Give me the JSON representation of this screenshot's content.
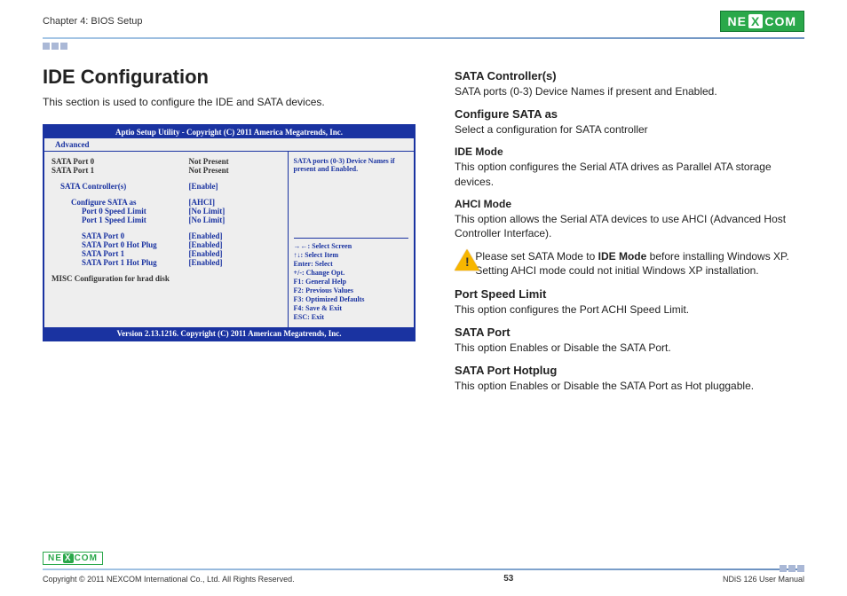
{
  "header": {
    "chapter": "Chapter 4: BIOS Setup",
    "logo_left": "NE",
    "logo_x": "X",
    "logo_right": "COM"
  },
  "title": "IDE Configuration",
  "intro": "This section is used to configure the IDE and SATA devices.",
  "bios": {
    "titlebar": "Aptio Setup Utility - Copyright (C) 2011 America Megatrends, Inc.",
    "tab": "Advanced",
    "rows": {
      "port0_lbl": "SATA Port 0",
      "port0_val": "Not Present",
      "port1_lbl": "SATA Port 1",
      "port1_val": "Not Present",
      "ctrl_lbl": "SATA Controller(s)",
      "ctrl_val": "[Enable]",
      "cfg_lbl": "Configure SATA as",
      "cfg_val": "[AHCI]",
      "p0s_lbl": "Port 0 Speed Limit",
      "p0s_val": "[No Limit]",
      "p1s_lbl": "Port 1 Speed Limit",
      "p1s_val": "[No Limit]",
      "sp0_lbl": "SATA Port 0",
      "sp0_val": "[Enabled]",
      "sp0h_lbl": "SATA Port 0 Hot Plug",
      "sp0h_val": "[Enabled]",
      "sp1_lbl": "SATA Port 1",
      "sp1_val": "[Enabled]",
      "sp1h_lbl": "SATA Port 1 Hot Plug",
      "sp1h_val": "[Enabled]",
      "misc": "MISC Configuration for hrad disk"
    },
    "help_top": "SATA ports (0-3) Device Names if present and Enabled.",
    "keys": {
      "k1": "→←: Select Screen",
      "k2": "↑↓: Select Item",
      "k3": "Enter: Select",
      "k4": "+/-: Change Opt.",
      "k5": "F1: General Help",
      "k6": "F2: Previous Values",
      "k7": "F3: Optimized Defaults",
      "k8": "F4: Save & Exit",
      "k9": "ESC: Exit"
    },
    "footer": "Version 2.13.1216. Copyright (C) 2011 American Megatrends, Inc."
  },
  "right": {
    "h_sata_ctrl": "SATA Controller(s)",
    "p_sata_ctrl": "SATA ports (0-3) Device Names if present and Enabled.",
    "h_cfg": "Configure SATA as",
    "p_cfg": "Select a configuration for SATA controller",
    "h_ide": "IDE Mode",
    "p_ide": "This option configures the Serial ATA drives as Parallel ATA storage devices.",
    "h_ahci": "AHCI Mode",
    "p_ahci": "This option allows the Serial ATA devices to use AHCI (Advanced Host Controller Interface).",
    "warn_a": "Please set SATA Mode to ",
    "warn_bold": "IDE Mode",
    "warn_b": " before installing Windows XP. Setting AHCI mode could not initial Windows XP installation.",
    "h_psl": "Port Speed Limit",
    "p_psl": "This option configures the Port ACHI Speed Limit.",
    "h_sp": "SATA Port",
    "p_sp": "This option Enables or Disable the SATA Port.",
    "h_sph": "SATA Port Hotplug",
    "p_sph": "This option Enables or Disable the SATA Port as Hot pluggable."
  },
  "footer": {
    "copyright": "Copyright © 2011 NEXCOM International Co., Ltd. All Rights Reserved.",
    "page": "53",
    "manual": "NDiS 126 User Manual"
  }
}
